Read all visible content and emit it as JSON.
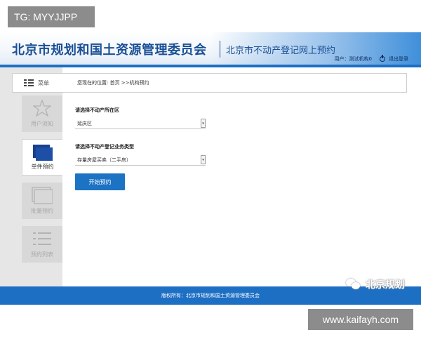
{
  "overlay": {
    "tag_top": "TG: MYYJJPP",
    "tag_bottom": "www.kaifayh.com",
    "watermark": "北京规划",
    "watermark_icon": "wechat-icon"
  },
  "header": {
    "org_title": "北京市规划和国土资源管理委员会",
    "sub_title": "北京市不动产登记网上预约",
    "user_text": "用户：测试机构0",
    "logout_label": "退出登录"
  },
  "sidebar": {
    "menu_label": "菜单",
    "items": [
      {
        "label": "用户须知",
        "icon": "star-icon",
        "active": false
      },
      {
        "label": "单件预约",
        "icon": "single-appointment-icon",
        "active": true
      },
      {
        "label": "批量预约",
        "icon": "batch-appointment-icon",
        "active": false
      },
      {
        "label": "预约列表",
        "icon": "list-icon",
        "active": false
      }
    ]
  },
  "main": {
    "breadcrumb": "您现在的位置:  首页 >>机构预约",
    "district_label": "请选择不动产所在区",
    "district_value": "延庆区",
    "business_label": "请选择不动产登记业务类型",
    "business_value": "存量房屋买卖（二手房）",
    "submit_label": "开始预约"
  },
  "footer": {
    "copyright": "版权所有：北京市规划和国土资源管理委员会"
  },
  "colors": {
    "brand_blue": "#1d6fc4",
    "title_blue": "#1a4f95",
    "button_blue": "#1c73c4",
    "sidebar_bg": "#e6e6e6"
  }
}
